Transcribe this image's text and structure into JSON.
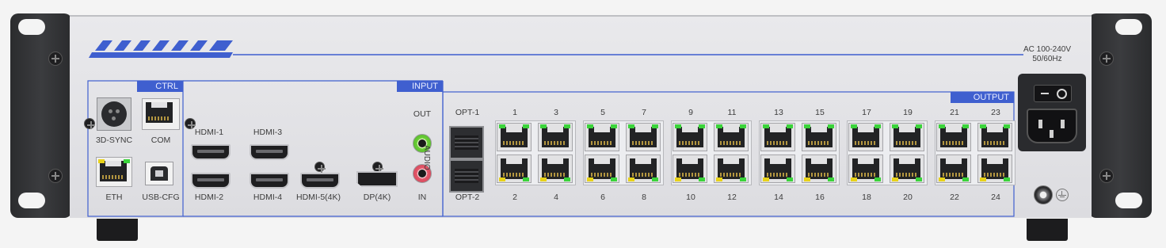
{
  "device": {
    "power_rating": "AC 100-240V",
    "power_freq": "50/60Hz",
    "stripe_color": "#3f5fcf"
  },
  "ctrl": {
    "title": "CTRL",
    "ports": {
      "sync": "3D-SYNC",
      "com": "COM",
      "eth": "ETH",
      "usb": "USB-CFG"
    }
  },
  "input": {
    "title": "INPUT",
    "ports": {
      "hdmi1": "HDMI-1",
      "hdmi2": "HDMI-2",
      "hdmi3": "HDMI-3",
      "hdmi4": "HDMI-4",
      "hdmi5": "HDMI-5(4K)",
      "dp": "DP(4K)"
    },
    "audio": {
      "label": "AUDIO",
      "out": "OUT",
      "in": "IN"
    }
  },
  "output": {
    "title": "OUTPUT",
    "opt1": "OPT-1",
    "opt2": "OPT-2",
    "top_labels": [
      "1",
      "3",
      "5",
      "7",
      "9",
      "11",
      "13",
      "15",
      "17",
      "19",
      "21",
      "23"
    ],
    "bottom_labels": [
      "2",
      "4",
      "6",
      "8",
      "10",
      "12",
      "14",
      "16",
      "18",
      "20",
      "22",
      "24"
    ]
  },
  "led_colors": {
    "green": "#3bd43b",
    "yellow": "#e8d21a"
  },
  "icons": {
    "ground": "ground-icon",
    "power_switch": "power-switch-icon",
    "ac_inlet": "ac-inlet-icon"
  }
}
